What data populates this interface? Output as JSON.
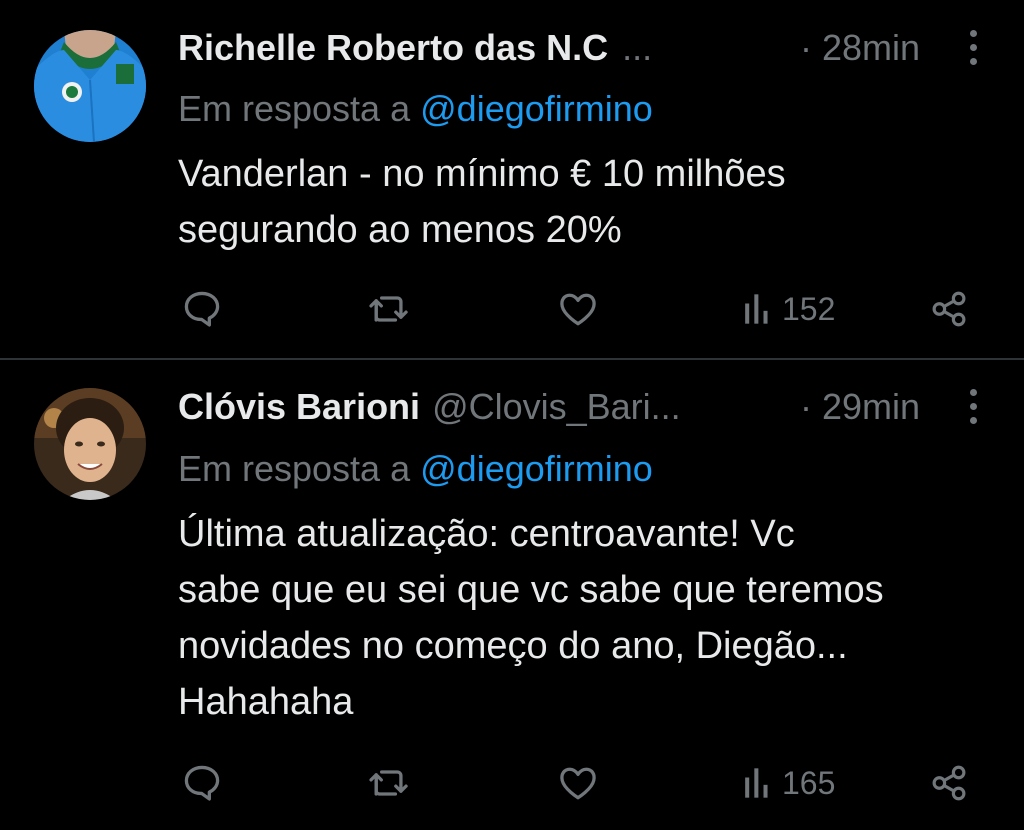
{
  "tweets": [
    {
      "display_name": "Richelle Roberto das N.C",
      "handle": "",
      "ellipsis": "...",
      "time": "· 28min",
      "reply_prefix": "Em resposta a",
      "reply_to": "@diegofirmino",
      "text_lines": [
        "Vanderlan - no mínimo € 10 milhões",
        "segurando ao menos 20%"
      ],
      "views": "152"
    },
    {
      "display_name": "Clóvis Barioni",
      "handle": "@Clovis_Bari...",
      "ellipsis": "",
      "time": "· 29min",
      "reply_prefix": "Em resposta a",
      "reply_to": "@diegofirmino",
      "text_lines": [
        "Última atualização: centroavante! Vc",
        "sabe que eu sei que vc sabe que teremos",
        "novidades no começo do ano, Diegão...",
        "Hahahaha"
      ],
      "views": "165"
    }
  ],
  "icons": {
    "reply": "reply-icon",
    "retweet": "retweet-icon",
    "like": "heart-icon",
    "views": "views-icon",
    "share": "share-icon",
    "more": "more-icon"
  },
  "colors": {
    "background": "#000000",
    "text": "#e7e9ea",
    "muted": "#71767b",
    "link": "#1d9bf0",
    "divider": "#2f3336"
  }
}
